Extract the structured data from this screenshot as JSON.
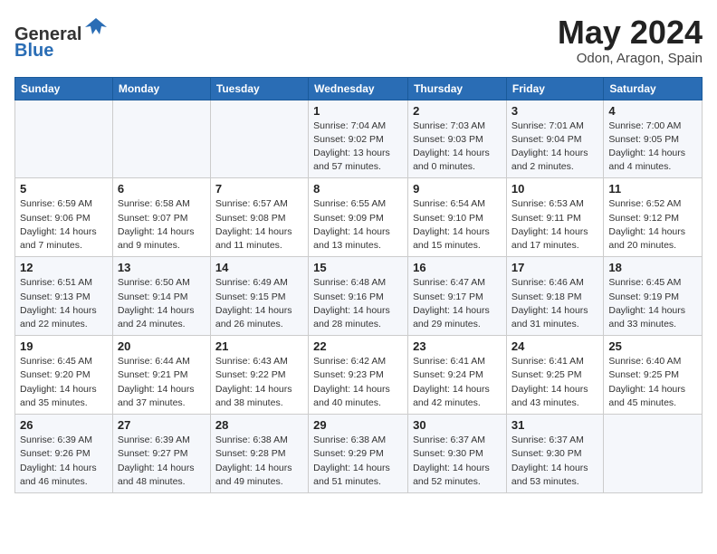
{
  "header": {
    "logo_line1": "General",
    "logo_line2": "Blue",
    "title": "May 2024",
    "subtitle": "Odon, Aragon, Spain"
  },
  "weekdays": [
    "Sunday",
    "Monday",
    "Tuesday",
    "Wednesday",
    "Thursday",
    "Friday",
    "Saturday"
  ],
  "weeks": [
    [
      {
        "day": "",
        "info": ""
      },
      {
        "day": "",
        "info": ""
      },
      {
        "day": "",
        "info": ""
      },
      {
        "day": "1",
        "info": "Sunrise: 7:04 AM\nSunset: 9:02 PM\nDaylight: 13 hours and 57 minutes."
      },
      {
        "day": "2",
        "info": "Sunrise: 7:03 AM\nSunset: 9:03 PM\nDaylight: 14 hours and 0 minutes."
      },
      {
        "day": "3",
        "info": "Sunrise: 7:01 AM\nSunset: 9:04 PM\nDaylight: 14 hours and 2 minutes."
      },
      {
        "day": "4",
        "info": "Sunrise: 7:00 AM\nSunset: 9:05 PM\nDaylight: 14 hours and 4 minutes."
      }
    ],
    [
      {
        "day": "5",
        "info": "Sunrise: 6:59 AM\nSunset: 9:06 PM\nDaylight: 14 hours and 7 minutes."
      },
      {
        "day": "6",
        "info": "Sunrise: 6:58 AM\nSunset: 9:07 PM\nDaylight: 14 hours and 9 minutes."
      },
      {
        "day": "7",
        "info": "Sunrise: 6:57 AM\nSunset: 9:08 PM\nDaylight: 14 hours and 11 minutes."
      },
      {
        "day": "8",
        "info": "Sunrise: 6:55 AM\nSunset: 9:09 PM\nDaylight: 14 hours and 13 minutes."
      },
      {
        "day": "9",
        "info": "Sunrise: 6:54 AM\nSunset: 9:10 PM\nDaylight: 14 hours and 15 minutes."
      },
      {
        "day": "10",
        "info": "Sunrise: 6:53 AM\nSunset: 9:11 PM\nDaylight: 14 hours and 17 minutes."
      },
      {
        "day": "11",
        "info": "Sunrise: 6:52 AM\nSunset: 9:12 PM\nDaylight: 14 hours and 20 minutes."
      }
    ],
    [
      {
        "day": "12",
        "info": "Sunrise: 6:51 AM\nSunset: 9:13 PM\nDaylight: 14 hours and 22 minutes."
      },
      {
        "day": "13",
        "info": "Sunrise: 6:50 AM\nSunset: 9:14 PM\nDaylight: 14 hours and 24 minutes."
      },
      {
        "day": "14",
        "info": "Sunrise: 6:49 AM\nSunset: 9:15 PM\nDaylight: 14 hours and 26 minutes."
      },
      {
        "day": "15",
        "info": "Sunrise: 6:48 AM\nSunset: 9:16 PM\nDaylight: 14 hours and 28 minutes."
      },
      {
        "day": "16",
        "info": "Sunrise: 6:47 AM\nSunset: 9:17 PM\nDaylight: 14 hours and 29 minutes."
      },
      {
        "day": "17",
        "info": "Sunrise: 6:46 AM\nSunset: 9:18 PM\nDaylight: 14 hours and 31 minutes."
      },
      {
        "day": "18",
        "info": "Sunrise: 6:45 AM\nSunset: 9:19 PM\nDaylight: 14 hours and 33 minutes."
      }
    ],
    [
      {
        "day": "19",
        "info": "Sunrise: 6:45 AM\nSunset: 9:20 PM\nDaylight: 14 hours and 35 minutes."
      },
      {
        "day": "20",
        "info": "Sunrise: 6:44 AM\nSunset: 9:21 PM\nDaylight: 14 hours and 37 minutes."
      },
      {
        "day": "21",
        "info": "Sunrise: 6:43 AM\nSunset: 9:22 PM\nDaylight: 14 hours and 38 minutes."
      },
      {
        "day": "22",
        "info": "Sunrise: 6:42 AM\nSunset: 9:23 PM\nDaylight: 14 hours and 40 minutes."
      },
      {
        "day": "23",
        "info": "Sunrise: 6:41 AM\nSunset: 9:24 PM\nDaylight: 14 hours and 42 minutes."
      },
      {
        "day": "24",
        "info": "Sunrise: 6:41 AM\nSunset: 9:25 PM\nDaylight: 14 hours and 43 minutes."
      },
      {
        "day": "25",
        "info": "Sunrise: 6:40 AM\nSunset: 9:25 PM\nDaylight: 14 hours and 45 minutes."
      }
    ],
    [
      {
        "day": "26",
        "info": "Sunrise: 6:39 AM\nSunset: 9:26 PM\nDaylight: 14 hours and 46 minutes."
      },
      {
        "day": "27",
        "info": "Sunrise: 6:39 AM\nSunset: 9:27 PM\nDaylight: 14 hours and 48 minutes."
      },
      {
        "day": "28",
        "info": "Sunrise: 6:38 AM\nSunset: 9:28 PM\nDaylight: 14 hours and 49 minutes."
      },
      {
        "day": "29",
        "info": "Sunrise: 6:38 AM\nSunset: 9:29 PM\nDaylight: 14 hours and 51 minutes."
      },
      {
        "day": "30",
        "info": "Sunrise: 6:37 AM\nSunset: 9:30 PM\nDaylight: 14 hours and 52 minutes."
      },
      {
        "day": "31",
        "info": "Sunrise: 6:37 AM\nSunset: 9:30 PM\nDaylight: 14 hours and 53 minutes."
      },
      {
        "day": "",
        "info": ""
      }
    ]
  ]
}
